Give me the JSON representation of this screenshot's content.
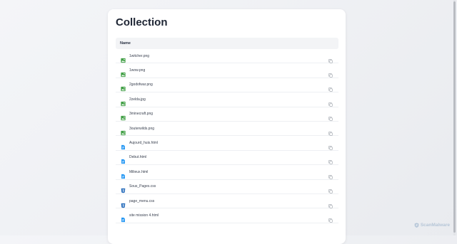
{
  "page": {
    "title": "Collection"
  },
  "table": {
    "header_name": "Name",
    "rows": [
      {
        "name": "1witcher.png",
        "type": "image"
      },
      {
        "name": "1wow.png",
        "type": "image"
      },
      {
        "name": "2godofwar.png",
        "type": "image"
      },
      {
        "name": "2zelda.jpg",
        "type": "image"
      },
      {
        "name": "3minecraft.png",
        "type": "image"
      },
      {
        "name": "3outerwilds.png",
        "type": "image"
      },
      {
        "name": "Aujourd_huis.html",
        "type": "html"
      },
      {
        "name": "Debut.html",
        "type": "html"
      },
      {
        "name": "Milieux.html",
        "type": "html"
      },
      {
        "name": "Sous_Pages.css",
        "type": "css"
      },
      {
        "name": "page_menu.css",
        "type": "css"
      },
      {
        "name": "site mission 4.html",
        "type": "html"
      }
    ]
  },
  "icons": {
    "image": "image-file-icon",
    "html": "document-file-icon",
    "css": "css-file-icon",
    "copy": "copy-icon"
  },
  "colors": {
    "image_icon": "#43a047",
    "html_icon": "#2196f3",
    "css_icon": "#1e66b8",
    "copy_icon": "#9aa0a8"
  },
  "watermark": {
    "text": "ScanMalware"
  }
}
